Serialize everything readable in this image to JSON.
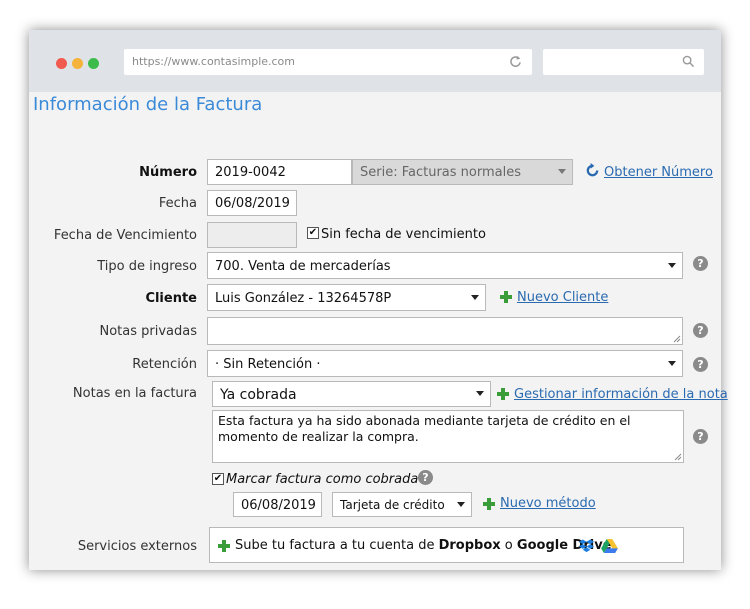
{
  "browser": {
    "url": "https://www.contasimple.com",
    "dot_colors": [
      "#f05a4f",
      "#f4b33a",
      "#3dbb4a"
    ]
  },
  "page_title": "Información de la Factura",
  "numero": {
    "label": "Número",
    "value": "2019-0042",
    "serie": "Serie: Facturas normales",
    "obtener_link": "Obtener Número"
  },
  "fecha": {
    "label": "Fecha",
    "value": "06/08/2019"
  },
  "vencimiento": {
    "label": "Fecha de Vencimiento",
    "value": "",
    "checkbox_label": "Sin fecha de vencimiento",
    "checked": true
  },
  "tipo_ingreso": {
    "label": "Tipo de ingreso",
    "value": "700. Venta de mercaderías"
  },
  "cliente": {
    "label": "Cliente",
    "value": "Luis González - 13264578P",
    "nuevo_link": "Nuevo Cliente"
  },
  "notas_privadas": {
    "label": "Notas privadas",
    "value": ""
  },
  "retencion": {
    "label": "Retención",
    "value": "· Sin Retención ·"
  },
  "notas_factura": {
    "label": "Notas en la factura",
    "select_value": "Ya cobrada",
    "gestionar_link": "Gestionar información de la nota",
    "text": "Esta factura ya ha sido abonada mediante tarjeta de crédito en el momento de realizar la compra."
  },
  "cobrada": {
    "checkbox_label": "Marcar factura como cobrada",
    "checked": true,
    "date": "06/08/2019",
    "metodo": "Tarjeta de crédito",
    "nuevo_metodo_link": "Nuevo método"
  },
  "servicios": {
    "label": "Servicios externos",
    "text_prefix": "Sube tu factura a tu cuenta de",
    "dropbox": "Dropbox",
    "o": "o",
    "gdrive": "Google Drive"
  },
  "colors": {
    "accent": "#3b8ad8",
    "link": "#2a6ab0",
    "plus": "#3a9d3a"
  }
}
